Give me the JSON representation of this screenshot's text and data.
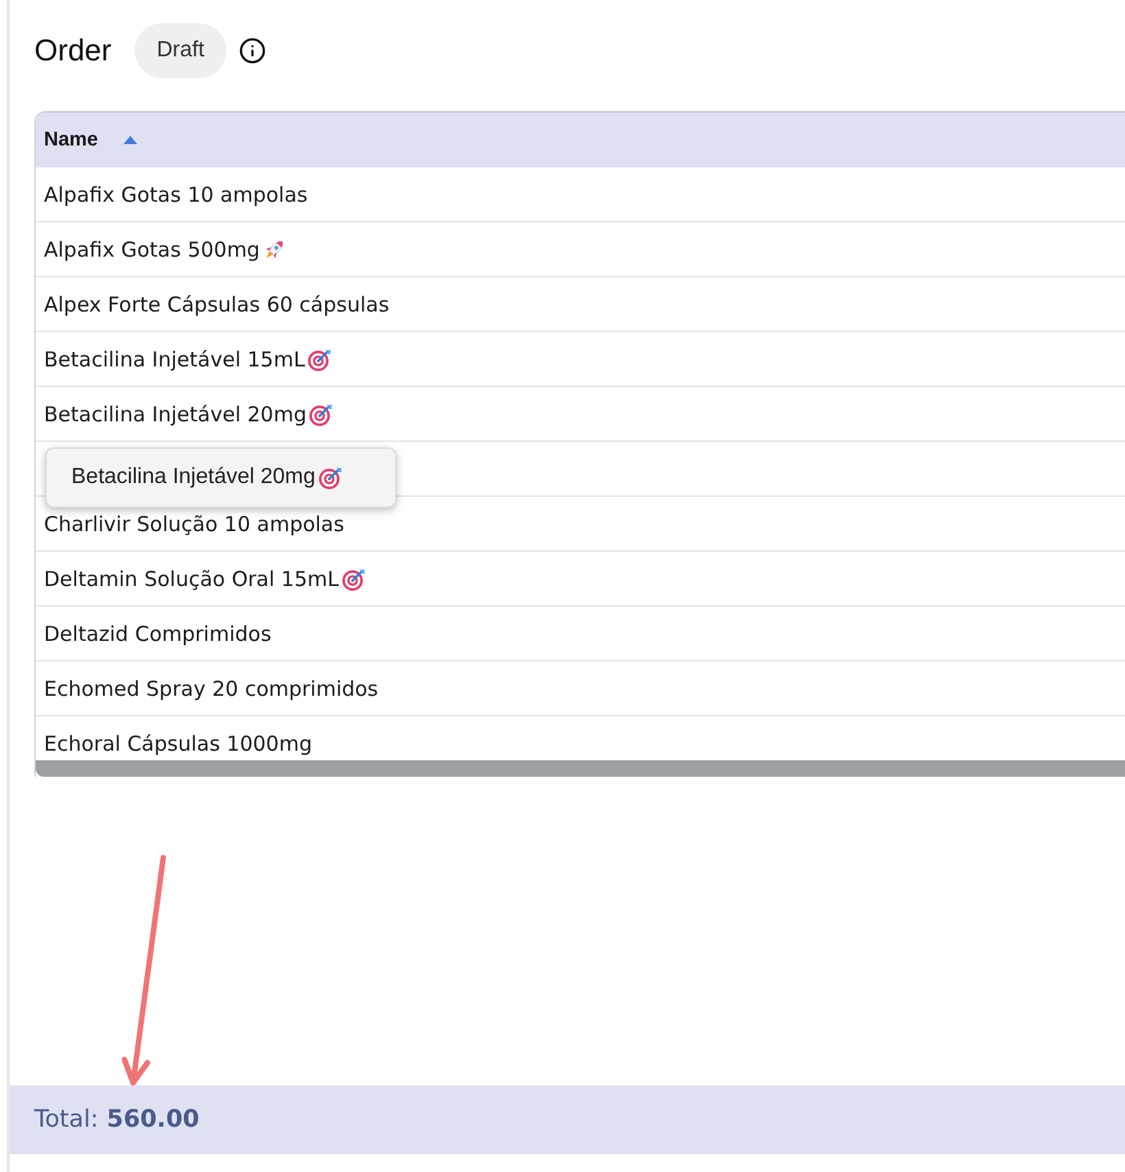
{
  "header": {
    "title": "Order",
    "status": "Draft"
  },
  "table": {
    "columns": [
      {
        "label": "Name",
        "sorted": true
      }
    ],
    "rows": [
      {
        "name": "Alpafix Gotas 10 ampolas",
        "kind": "plain"
      },
      {
        "name": "Alpafix Gotas 500mg",
        "kind": "rocket"
      },
      {
        "name": "Alpex Forte Cápsulas 60 cápsulas",
        "kind": "plain"
      },
      {
        "name": "Betacilina Injetável 15mL",
        "kind": "target"
      },
      {
        "name": "Betacilina Injetável 20mg",
        "kind": "target",
        "tooltip": {
          "text": "Betacilina Injetável 20mg",
          "kind": "target"
        }
      },
      {
        "name": "Charlivir Solução 10 ampolas",
        "kind": "plain"
      },
      {
        "name": "Deltamin Solução Oral 15mL",
        "kind": "target"
      },
      {
        "name": "Deltazid Comprimidos",
        "kind": "plain"
      },
      {
        "name": "Echomed Spray 20 comprimidos",
        "kind": "plain"
      },
      {
        "name": "Echoral Cápsulas 1000mg",
        "kind": "plain"
      }
    ]
  },
  "total": {
    "label": "Total:",
    "value": "560.00"
  }
}
